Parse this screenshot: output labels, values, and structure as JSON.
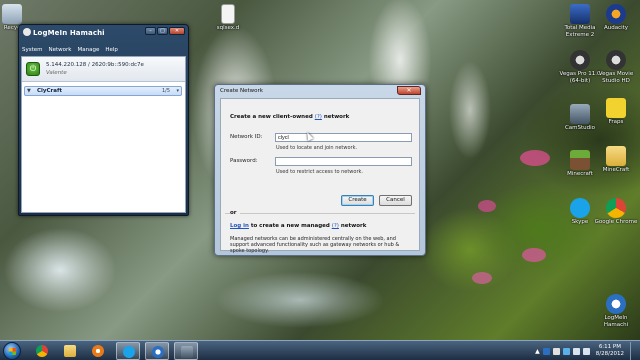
{
  "colors": {
    "hamachi_frame": "#2d4a6a",
    "dialog_frame": "#b3c6da",
    "link": "#2255bb",
    "power_on": "#3fa52a",
    "taskbar": "#1d2e43"
  },
  "desktop_icons": [
    {
      "label": "Recyc",
      "icon": "recycle-bin-icon"
    },
    {
      "label": "sqlsex.d",
      "icon": "file-icon"
    },
    {
      "label": "Total Media Extreme 2",
      "icon": "total-media-icon"
    },
    {
      "label": "Audacity",
      "icon": "audacity-icon"
    },
    {
      "label": "Vegas Pro 11.0 (64-bit)",
      "icon": "vegas-pro-icon"
    },
    {
      "label": "Vegas Movie Studio HD",
      "icon": "vegas-movie-studio-icon"
    },
    {
      "label": "CamStudio",
      "icon": "camstudio-icon"
    },
    {
      "label": "Fraps",
      "icon": "fraps-icon"
    },
    {
      "label": "Minecraft",
      "icon": "minecraft-icon"
    },
    {
      "label": "MineCraft",
      "icon": "folder-icon"
    },
    {
      "label": "Skype",
      "icon": "skype-icon"
    },
    {
      "label": "Google Chrome",
      "icon": "chrome-icon"
    },
    {
      "label": "LogMeIn Hamachi",
      "icon": "hamachi-icon"
    }
  ],
  "hamachi": {
    "title": "LogMeIn Hamachi",
    "menu": [
      "System",
      "Network",
      "Manage",
      "Help"
    ],
    "ip": "5.144.220.128 / 2620:9b::590:dc7e",
    "user": "Valente",
    "network_name": "ClyCraft",
    "network_count": "1/5"
  },
  "dialog": {
    "title": "Create Network",
    "heading_pre": "Create a new client-owned",
    "heading_help": "(?)",
    "heading_post": "network",
    "network_id_label": "Network ID:",
    "network_id_value": "clycl",
    "network_id_hint": "Used to locate and join network.",
    "password_label": "Password:",
    "password_value": "",
    "password_hint": "Used to restrict access to network.",
    "create_label": "Create",
    "cancel_label": "Cancel",
    "or_label": "or",
    "managed_login": "Log in",
    "managed_mid": "to create a new managed",
    "managed_help": "(?)",
    "managed_post": "network",
    "description": "Managed networks can be administered centrally on the web, and support advanced functionality such as gateway networks or hub & spoke topology."
  },
  "taskbar": {
    "pinned": [
      {
        "name": "chrome",
        "icon": "chrome-icon"
      },
      {
        "name": "explorer",
        "icon": "folder-icon"
      },
      {
        "name": "media-player",
        "icon": "media-player-icon"
      },
      {
        "name": "skype",
        "icon": "skype-icon"
      },
      {
        "name": "hamachi",
        "icon": "hamachi-icon"
      },
      {
        "name": "camstudio",
        "icon": "camstudio-icon"
      }
    ],
    "time": "6:11 PM",
    "date": "8/28/2012"
  }
}
